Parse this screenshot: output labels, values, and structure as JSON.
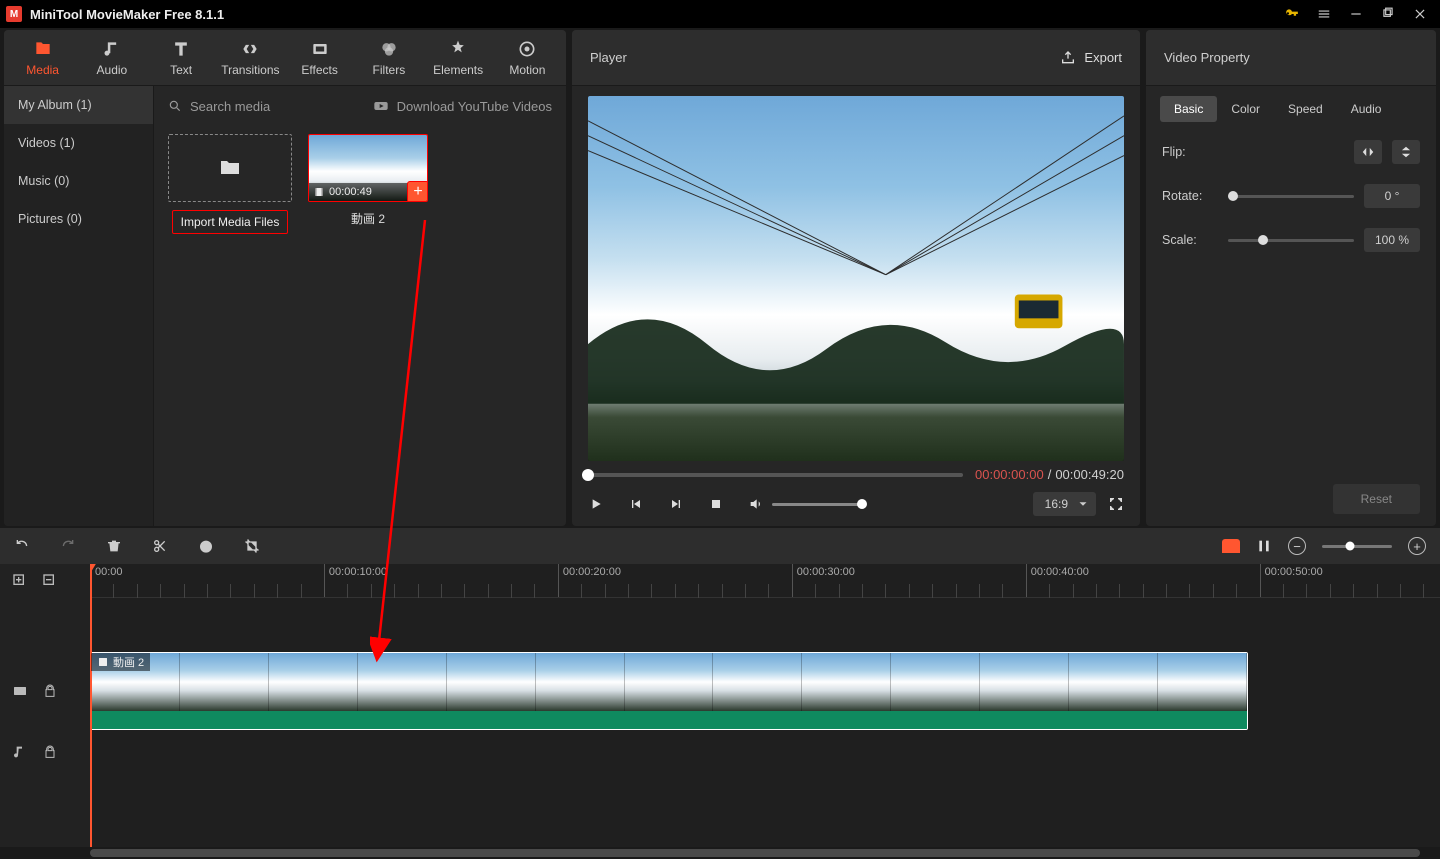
{
  "app": {
    "title": "MiniTool MovieMaker Free 8.1.1"
  },
  "tabs": {
    "media": "Media",
    "audio": "Audio",
    "text": "Text",
    "transitions": "Transitions",
    "effects": "Effects",
    "filters": "Filters",
    "elements": "Elements",
    "motion": "Motion"
  },
  "sidebar": {
    "album": "My Album (1)",
    "videos": "Videos (1)",
    "music": "Music (0)",
    "pictures": "Pictures (0)"
  },
  "media": {
    "search_placeholder": "Search media",
    "download_link": "Download YouTube Videos",
    "import_label": "Import Media Files",
    "clip_duration": "00:00:49",
    "clip_name": "動画 2"
  },
  "player": {
    "title": "Player",
    "export": "Export",
    "time_current": "00:00:00:00",
    "time_sep": " / ",
    "time_total": "00:00:49:20",
    "aspect": "16:9"
  },
  "props": {
    "title": "Video Property",
    "tab_basic": "Basic",
    "tab_color": "Color",
    "tab_speed": "Speed",
    "tab_audio": "Audio",
    "flip_label": "Flip:",
    "rotate_label": "Rotate:",
    "rotate_value": "0 °",
    "scale_label": "Scale:",
    "scale_value": "100 %",
    "reset": "Reset"
  },
  "timeline": {
    "ruler": [
      "00:00",
      "00:00:10:00",
      "00:00:20:00",
      "00:00:30:00",
      "00:00:40:00",
      "00:00:50:00"
    ],
    "clip_label": "動画 2"
  }
}
